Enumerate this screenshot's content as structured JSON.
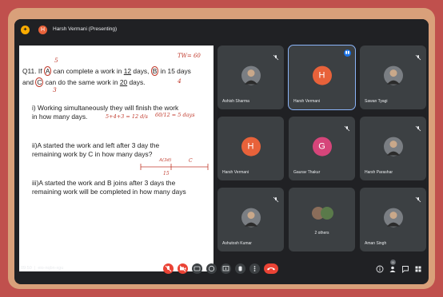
{
  "meeting": {
    "presenter_label": "Harsh Vermani (Presenting)",
    "presenter_initial": "H",
    "time": "09:50",
    "code": "eio-nqbn-xgu",
    "participant_count": "11"
  },
  "slide": {
    "q_num": "Q11.",
    "line1_a": " If ",
    "name_a": "A",
    "line1_b": " can complete a work in ",
    "days_12": "12",
    "line1_c": " days, ",
    "name_b": "B",
    "line1_d": " in 15 days",
    "line2_a": "and ",
    "name_c": "C",
    "line2_b": " can do the  same work in ",
    "days_20": "20",
    "line2_c": " days.",
    "part1_line1": "i) Working simultaneously they will finish the work",
    "part1_line2": "in how many days.",
    "part2_line1": "ii)A started the work and left after 3 day the",
    "part2_line2": "remaining work by C in how many days?",
    "part3_line1": "iii)A started the work and B joins after 3 days the",
    "part3_line2": "remaining work will be completed in how many days"
  },
  "annotations": {
    "tw": "TW= 60",
    "a_rate": "5",
    "b_rate": "4",
    "c_rate": "3",
    "sum": "5+4+3 = 12 d/s",
    "div": "60/12 = 5 days",
    "bar_label": "A(3d)",
    "bar_c": "C",
    "bar_15": "15"
  },
  "tiles": [
    {
      "name": "Ashish Sharma",
      "type": "photo",
      "mic_off": true
    },
    {
      "name": "Harsh Vermani",
      "type": "initial",
      "initial": "H",
      "color": "#e8623a",
      "speaking": true
    },
    {
      "name": "Sawan Tyagi",
      "type": "photo",
      "mic_off": true
    },
    {
      "name": "Harsh Vermani",
      "type": "initial",
      "initial": "H",
      "color": "#e8623a",
      "mic_off": false
    },
    {
      "name": "Gaurav Thakur",
      "type": "initial",
      "initial": "G",
      "color": "#d6457a",
      "mic_off": true
    },
    {
      "name": "Harsh Parashar",
      "type": "photo",
      "mic_off": true
    },
    {
      "name": "Ashutosh Kumar",
      "type": "photo",
      "mic_off": true
    },
    {
      "name": "2 others",
      "type": "group",
      "mic_off": false
    },
    {
      "name": "Aman Singh",
      "type": "photo",
      "mic_off": true
    }
  ],
  "colors": {
    "frame_outer": "#c0504d",
    "frame_inner": "#d9a07a",
    "meet_bg": "#202124",
    "tile_bg": "#3c4043",
    "end_call": "#ea4335",
    "speaking": "#1a73e8"
  },
  "controls": {
    "icons": [
      "mic-off-icon",
      "camera-off-icon",
      "captions-icon",
      "emoji-icon",
      "present-icon",
      "raise-hand-icon",
      "more-icon",
      "end-call-icon"
    ],
    "right_icons": [
      "info-icon",
      "people-icon",
      "chat-icon",
      "activities-icon"
    ]
  }
}
